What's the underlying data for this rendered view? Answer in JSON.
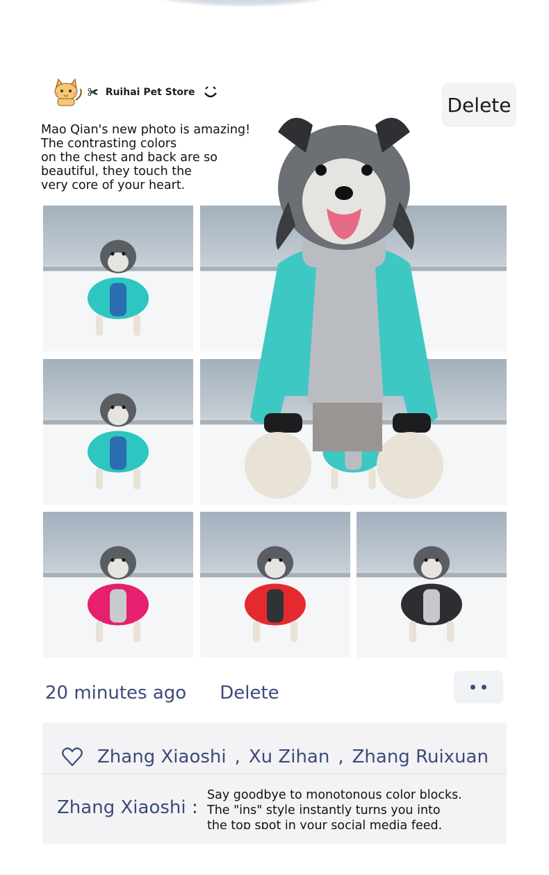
{
  "post": {
    "store_name": "Ruihai Pet Store",
    "delete_label": "Delete",
    "caption": "Mao Qian's new photo is amazing!\nThe contrasting colors\non the chest and back are so\nbeautiful, they touch the\nvery core of your heart.",
    "photos": [
      {
        "coat": "#2ec6c1",
        "accent": "#2b6db0"
      },
      {
        "coat": "#3ec8c4",
        "accent": "#b9bcc1"
      },
      {
        "coat": "#2ec6c1",
        "accent": "#2b6db0"
      },
      {
        "coat": "#3ec8c4",
        "accent": "#b9bcc1"
      },
      {
        "coat": "#e61f6e",
        "accent": "#c8cace"
      },
      {
        "coat": "#e52a2f",
        "accent": "#2f3236"
      },
      {
        "coat": "#2c2e31",
        "accent": "#c6c8cc"
      }
    ]
  },
  "meta": {
    "timestamp": "20 minutes ago",
    "delete_label": "Delete"
  },
  "likes": {
    "names": [
      "Zhang Xiaoshi",
      "Xu Zihan",
      "Zhang Ruixuan"
    ],
    "separator": ","
  },
  "comment": {
    "author": "Zhang Xiaoshi",
    "colon": ":",
    "text": "Say goodbye to monotonous color blocks.\nThe \"ins\" style instantly turns you into\nthe top spot in your social media feed."
  },
  "colors": {
    "link": "#3c4a7a",
    "panel": "#f3f3f5"
  }
}
